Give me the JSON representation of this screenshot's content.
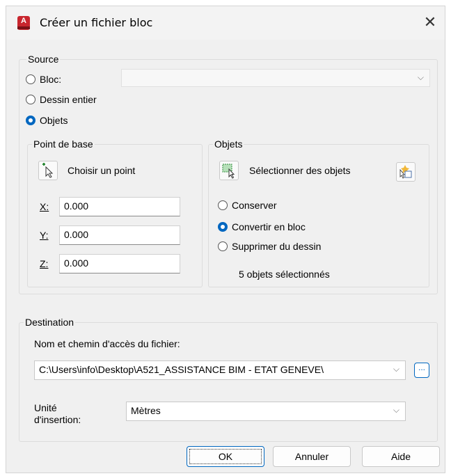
{
  "window": {
    "title": "Créer un fichier bloc",
    "close_glyph": "✕",
    "icon_letter": "A"
  },
  "source": {
    "legend": "Source",
    "bloc_label": "Bloc:",
    "dessin_label": "Dessin entier",
    "objets_label": "Objets",
    "selected": "Objets",
    "bloc_combo_value": ""
  },
  "base_point": {
    "legend": "Point de base",
    "pick_label": "Choisir un point",
    "x_label": "X:",
    "x_value": "0.000",
    "y_label": "Y:",
    "y_value": "0.000",
    "z_label": "Z:",
    "z_value": "0.000"
  },
  "objects": {
    "legend": "Objets",
    "select_label": "Sélectionner des objets",
    "keep_label": "Conserver",
    "convert_label": "Convertir en bloc",
    "delete_label": "Supprimer du dessin",
    "selected_option": "Convertir en bloc",
    "status": "5 objets sélectionnés"
  },
  "destination": {
    "legend": "Destination",
    "path_label": "Nom et chemin d'accès du fichier:",
    "path_value": "C:\\Users\\info\\Desktop\\A521_ASSISTANCE BIM - ETAT GENEVE\\",
    "browse_label": "...",
    "unit_label_line1": "Unité",
    "unit_label_line2": "d'insertion:",
    "unit_value": "Mètres"
  },
  "buttons": {
    "ok": "OK",
    "cancel": "Annuler",
    "help": "Aide"
  },
  "colors": {
    "accent": "#0067c0",
    "app_icon": "#c8262e"
  }
}
